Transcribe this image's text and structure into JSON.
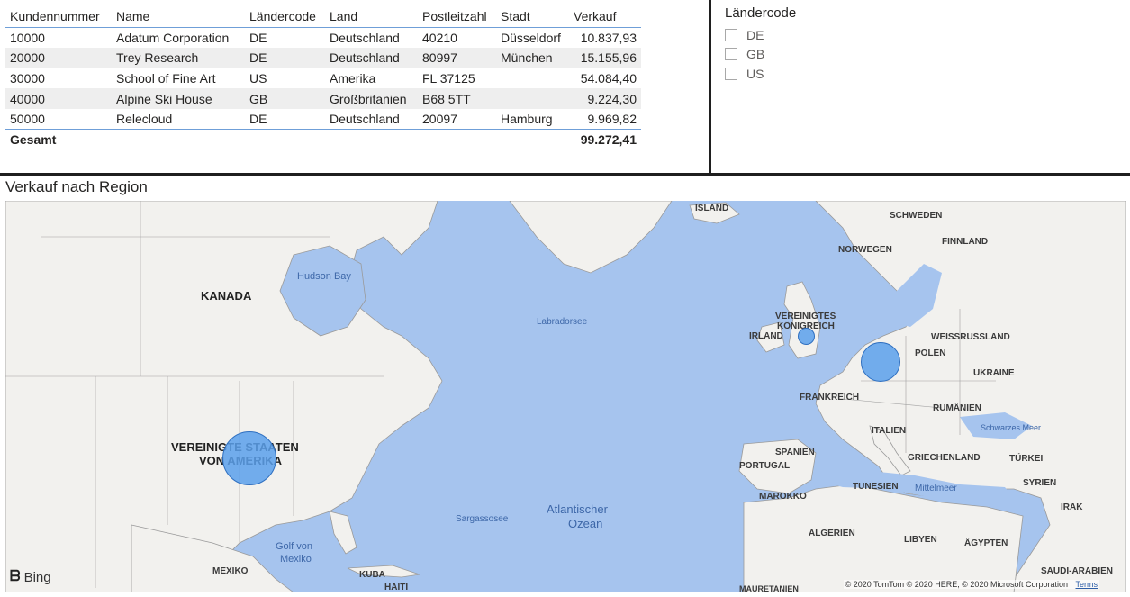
{
  "table": {
    "headers": [
      "Kundennummer",
      "Name",
      "Ländercode",
      "Land",
      "Postleitzahl",
      "Stadt",
      "Verkauf"
    ],
    "rows": [
      [
        "10000",
        "Adatum Corporation",
        "DE",
        "Deutschland",
        "40210",
        "Düsseldorf",
        "10.837,93"
      ],
      [
        "20000",
        "Trey Research",
        "DE",
        "Deutschland",
        "80997",
        "München",
        "15.155,96"
      ],
      [
        "30000",
        "School of Fine Art",
        "US",
        "Amerika",
        "FL 37125",
        "",
        "54.084,40"
      ],
      [
        "40000",
        "Alpine Ski House",
        "GB",
        "Großbritanien",
        "B68 5TT",
        "",
        "9.224,30"
      ],
      [
        "50000",
        "Relecloud",
        "DE",
        "Deutschland",
        "20097",
        "Hamburg",
        "9.969,82"
      ]
    ],
    "total_label": "Gesamt",
    "total_value": "99.272,41"
  },
  "slicer": {
    "title": "Ländercode",
    "items": [
      "DE",
      "GB",
      "US"
    ]
  },
  "map": {
    "title": "Verkauf nach Region",
    "bing_label": "Bing",
    "copyright": "© 2020 TomTom © 2020 HERE, © 2020 Microsoft Corporation",
    "terms": "Terms",
    "labels": {
      "island": "ISLAND",
      "schweden": "SCHWEDEN",
      "finnland": "FINNLAND",
      "norwegen": "NORWEGEN",
      "kanada": "KANADA",
      "hudson": "Hudson Bay",
      "labradorsee": "Labradorsee",
      "vk1": "VEREINIGTES",
      "vk2": "KÖNIGREICH",
      "irland": "IRLAND",
      "weissrussland": "WEISSRUSSLAND",
      "polen": "POLEN",
      "ukraine": "UKRAINE",
      "frankreich": "FRANKREICH",
      "rumaenien": "RUMÄNIEN",
      "schwarzes": "Schwarzes Meer",
      "italien": "ITALIEN",
      "spanien": "SPANIEN",
      "portugal": "PORTUGAL",
      "griechenland": "GRIECHENLAND",
      "tuerkei": "TÜRKEI",
      "usa1": "VEREINIGTE STAATEN",
      "usa2": "VON AMERIKA",
      "marokko": "MAROKKO",
      "tunesien": "TUNESIEN",
      "mittelmeer": "Mittelmeer",
      "syrien": "SYRIEN",
      "irak": "IRAK",
      "atlantik1": "Atlantischer",
      "atlantik2": "Ozean",
      "sargasso": "Sargassosee",
      "algerien": "ALGERIEN",
      "libyen": "LIBYEN",
      "aegypten": "ÄGYPTEN",
      "golf1": "Golf von",
      "golf2": "Mexiko",
      "mexiko": "MEXIKO",
      "kuba": "KUBA",
      "haiti": "HAITI",
      "saudi": "SAUDI-ARABIEN",
      "mauretanien": "MAURETANIEN"
    },
    "bubbles": [
      {
        "region": "US",
        "value": "54.084,40"
      },
      {
        "region": "GB",
        "value": "9.224,30"
      },
      {
        "region": "DE",
        "value": "35.963,71"
      }
    ]
  },
  "colors": {
    "water": "#a6c4ee",
    "land": "#f2f1ee",
    "bubble": "#5aa0eb",
    "table_line": "#6f9fd8"
  }
}
